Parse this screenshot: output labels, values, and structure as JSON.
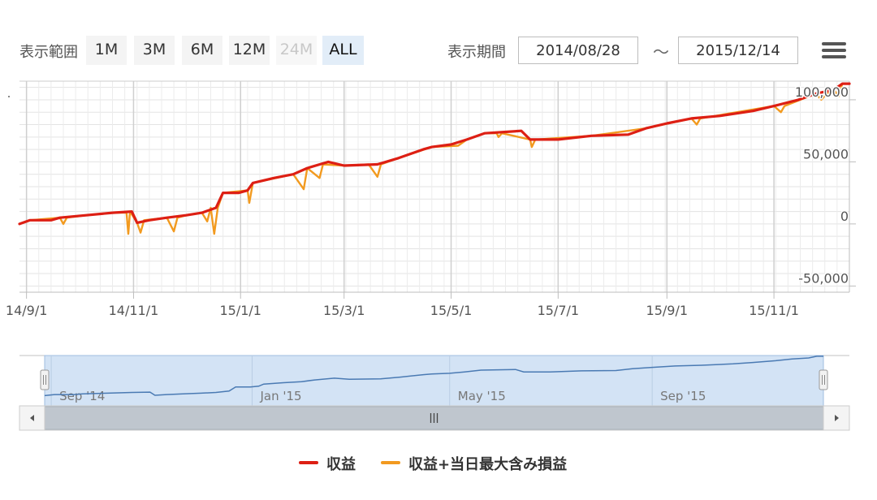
{
  "toolbar": {
    "range_label": "表示範囲",
    "range_buttons": [
      {
        "label": "1M",
        "state": "normal"
      },
      {
        "label": "3M",
        "state": "normal"
      },
      {
        "label": "6M",
        "state": "normal"
      },
      {
        "label": "12M",
        "state": "normal"
      },
      {
        "label": "24M",
        "state": "disabled"
      },
      {
        "label": "ALL",
        "state": "selected"
      }
    ],
    "period_label": "表示期間",
    "from_date": "2014/08/28",
    "to_date": "2015/12/14",
    "separator": "〜",
    "menu_icon": "hamburger-menu-icon"
  },
  "chart_data": {
    "type": "line",
    "title": "",
    "xlabel": "",
    "ylabel": "",
    "x_range": [
      "2014-08-28",
      "2015-12-14"
    ],
    "ylim": [
      -55000,
      115000
    ],
    "y_ticks": [
      -50000,
      0,
      50000,
      100000
    ],
    "y_tick_labels": [
      "-50,000",
      "0",
      "50,000",
      "100,000"
    ],
    "x_ticks": [
      "2014-09-01",
      "2014-11-01",
      "2015-01-01",
      "2015-03-01",
      "2015-05-01",
      "2015-07-01",
      "2015-09-01",
      "2015-11-01"
    ],
    "x_tick_labels": [
      "14/9/1",
      "14/11/1",
      "15/1/1",
      "15/3/1",
      "15/5/1",
      "15/7/1",
      "15/9/1",
      "15/11/1"
    ],
    "grid": true,
    "legend_position": "bottom-center",
    "series": [
      {
        "name": "収益",
        "color": "#dd1f14",
        "points": [
          [
            "2014-08-28",
            0
          ],
          [
            "2014-09-03",
            3000
          ],
          [
            "2014-09-15",
            3000
          ],
          [
            "2014-09-20",
            5000
          ],
          [
            "2014-10-05",
            7000
          ],
          [
            "2014-10-20",
            9000
          ],
          [
            "2014-10-31",
            10000
          ],
          [
            "2014-11-03",
            1000
          ],
          [
            "2014-11-10",
            3000
          ],
          [
            "2014-11-20",
            5000
          ],
          [
            "2014-12-01",
            7000
          ],
          [
            "2014-12-10",
            9000
          ],
          [
            "2014-12-18",
            13000
          ],
          [
            "2014-12-22",
            25000
          ],
          [
            "2014-12-31",
            25000
          ],
          [
            "2015-01-05",
            27000
          ],
          [
            "2015-01-08",
            33000
          ],
          [
            "2015-01-20",
            37000
          ],
          [
            "2015-01-31",
            40000
          ],
          [
            "2015-02-08",
            45000
          ],
          [
            "2015-02-20",
            50000
          ],
          [
            "2015-03-01",
            47000
          ],
          [
            "2015-03-20",
            48000
          ],
          [
            "2015-04-01",
            53000
          ],
          [
            "2015-04-15",
            60000
          ],
          [
            "2015-04-20",
            62000
          ],
          [
            "2015-05-01",
            64000
          ],
          [
            "2015-05-10",
            68000
          ],
          [
            "2015-05-20",
            73000
          ],
          [
            "2015-06-10",
            75000
          ],
          [
            "2015-06-15",
            68000
          ],
          [
            "2015-07-01",
            68000
          ],
          [
            "2015-07-20",
            71000
          ],
          [
            "2015-08-10",
            72000
          ],
          [
            "2015-08-20",
            77000
          ],
          [
            "2015-09-01",
            81000
          ],
          [
            "2015-09-15",
            85000
          ],
          [
            "2015-10-01",
            87000
          ],
          [
            "2015-10-20",
            91000
          ],
          [
            "2015-11-01",
            95000
          ],
          [
            "2015-11-15",
            100000
          ],
          [
            "2015-11-25",
            105000
          ],
          [
            "2015-12-05",
            108000
          ],
          [
            "2015-12-10",
            113000
          ],
          [
            "2015-12-14",
            113000
          ]
        ]
      },
      {
        "name": "収益+当日最大含み損益",
        "color": "#f29a1f",
        "points": [
          [
            "2014-08-28",
            0
          ],
          [
            "2014-09-03",
            3000
          ],
          [
            "2014-09-20",
            5000
          ],
          [
            "2014-09-22",
            0
          ],
          [
            "2014-09-24",
            5000
          ],
          [
            "2014-10-05",
            7000
          ],
          [
            "2014-10-20",
            9000
          ],
          [
            "2014-10-28",
            9000
          ],
          [
            "2014-10-29",
            -8000
          ],
          [
            "2014-10-30",
            10000
          ],
          [
            "2014-11-03",
            1000
          ],
          [
            "2014-11-05",
            -7000
          ],
          [
            "2014-11-07",
            3000
          ],
          [
            "2014-11-20",
            5000
          ],
          [
            "2014-11-24",
            -6000
          ],
          [
            "2014-11-26",
            5000
          ],
          [
            "2014-12-01",
            7000
          ],
          [
            "2014-12-10",
            9000
          ],
          [
            "2014-12-13",
            2000
          ],
          [
            "2014-12-15",
            13000
          ],
          [
            "2014-12-17",
            -8000
          ],
          [
            "2014-12-19",
            13000
          ],
          [
            "2014-12-22",
            25000
          ],
          [
            "2015-01-05",
            27000
          ],
          [
            "2015-01-06",
            17000
          ],
          [
            "2015-01-08",
            33000
          ],
          [
            "2015-01-31",
            40000
          ],
          [
            "2015-02-06",
            28000
          ],
          [
            "2015-02-08",
            45000
          ],
          [
            "2015-02-15",
            37000
          ],
          [
            "2015-02-17",
            48000
          ],
          [
            "2015-03-01",
            47000
          ],
          [
            "2015-03-15",
            48000
          ],
          [
            "2015-03-20",
            38000
          ],
          [
            "2015-03-22",
            48000
          ],
          [
            "2015-04-01",
            53000
          ],
          [
            "2015-04-20",
            62000
          ],
          [
            "2015-05-05",
            63000
          ],
          [
            "2015-05-10",
            68000
          ],
          [
            "2015-05-20",
            73000
          ],
          [
            "2015-05-27",
            73000
          ],
          [
            "2015-05-28",
            70000
          ],
          [
            "2015-05-30",
            73000
          ],
          [
            "2015-06-15",
            68000
          ],
          [
            "2015-06-16",
            62000
          ],
          [
            "2015-06-18",
            68000
          ],
          [
            "2015-07-20",
            71000
          ],
          [
            "2015-08-20",
            77000
          ],
          [
            "2015-09-15",
            85000
          ],
          [
            "2015-09-18",
            80000
          ],
          [
            "2015-09-20",
            85000
          ],
          [
            "2015-11-01",
            95000
          ],
          [
            "2015-11-05",
            90000
          ],
          [
            "2015-11-07",
            95000
          ],
          [
            "2015-11-25",
            105000
          ],
          [
            "2015-11-28",
            100000
          ],
          [
            "2015-12-01",
            105000
          ],
          [
            "2015-12-05",
            108000
          ],
          [
            "2015-12-08",
            103000
          ],
          [
            "2015-12-10",
            113000
          ],
          [
            "2015-12-14",
            113000
          ]
        ]
      }
    ]
  },
  "navigator": {
    "labels": [
      "Sep '14",
      "Jan '15",
      "May '15",
      "Sep '15"
    ],
    "label_dates": [
      "2014-09-01",
      "2015-01-01",
      "2015-05-01",
      "2015-09-01"
    ],
    "selected_range": [
      "2014-08-28",
      "2015-12-14"
    ],
    "scrollbar_left_icon": "arrow-left-icon",
    "scrollbar_right_icon": "arrow-right-icon",
    "scrollbar_grip_icon": "grip-lines-icon"
  },
  "legend": [
    {
      "label": "収益",
      "color": "#dd1f14"
    },
    {
      "label": "収益+当日最大含み損益",
      "color": "#f29a1f"
    }
  ]
}
